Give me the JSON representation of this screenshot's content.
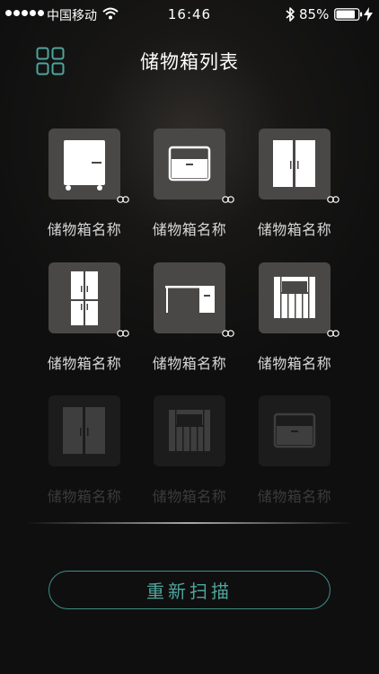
{
  "status_bar": {
    "carrier": "中国移动",
    "time": "16:46",
    "battery_percent": "85%",
    "signal_bars": 5,
    "icons": [
      "wifi-icon",
      "bluetooth-icon",
      "battery-icon",
      "charging-icon"
    ]
  },
  "header": {
    "title": "储物箱列表",
    "menu_icon": "grid-icon"
  },
  "tiles": [
    {
      "name": "储物箱名称",
      "icon": "fridge-icon",
      "active": true,
      "link_icon": true
    },
    {
      "name": "储物箱名称",
      "icon": "drawer-icon",
      "active": true,
      "link_icon": true
    },
    {
      "name": "储物箱名称",
      "icon": "wardrobe-icon",
      "active": true,
      "link_icon": true
    },
    {
      "name": "储物箱名称",
      "icon": "double-door-fridge-icon",
      "active": true,
      "link_icon": true
    },
    {
      "name": "储物箱名称",
      "icon": "desk-icon",
      "active": true,
      "link_icon": true
    },
    {
      "name": "储物箱名称",
      "icon": "cabinet-icon",
      "active": true,
      "link_icon": true
    },
    {
      "name": "储物箱名称",
      "icon": "wardrobe-icon",
      "active": false,
      "link_icon": false
    },
    {
      "name": "储物箱名称",
      "icon": "cabinet-icon",
      "active": false,
      "link_icon": false
    },
    {
      "name": "储物箱名称",
      "icon": "drawer-icon",
      "active": false,
      "link_icon": false
    }
  ],
  "rescan_button": {
    "label": "重新扫描"
  },
  "colors": {
    "accent": "#4ea59c",
    "tile_active": "#4a4847",
    "tile_inactive": "#1c1c1c",
    "background": "#0f0f0f"
  }
}
